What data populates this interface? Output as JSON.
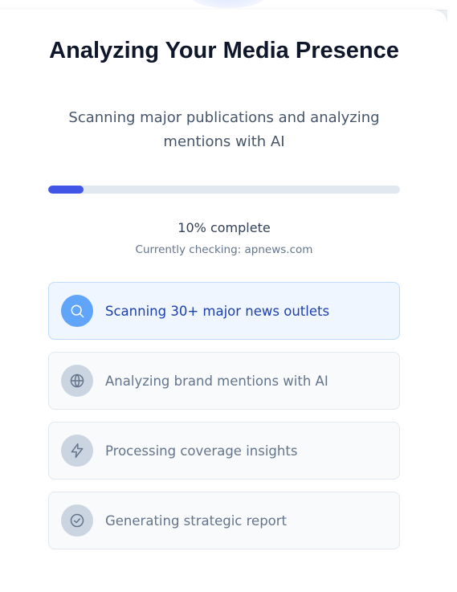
{
  "header": {
    "title": "Analyzing Your Media Presence",
    "subtitle": "Scanning major publications and analyzing mentions with AI"
  },
  "progress": {
    "value_percent": 10,
    "label": "10% complete",
    "status": "Currently checking: apnews.com"
  },
  "steps": [
    {
      "label": "Scanning 30+ major news outlets",
      "icon": "search-icon",
      "state": "active"
    },
    {
      "label": "Analyzing brand mentions with AI",
      "icon": "globe-icon",
      "state": "pending"
    },
    {
      "label": "Processing coverage insights",
      "icon": "lightning-icon",
      "state": "pending"
    },
    {
      "label": "Generating strategic report",
      "icon": "check-circle-icon",
      "state": "pending"
    }
  ],
  "colors": {
    "accent": "#4055e6",
    "active_step_bg": "#eff6ff",
    "active_step_text": "#1e40af",
    "active_icon_bg": "#60a5fa",
    "pending_icon_bg": "#cbd5e1",
    "track": "#e2e8f0"
  }
}
